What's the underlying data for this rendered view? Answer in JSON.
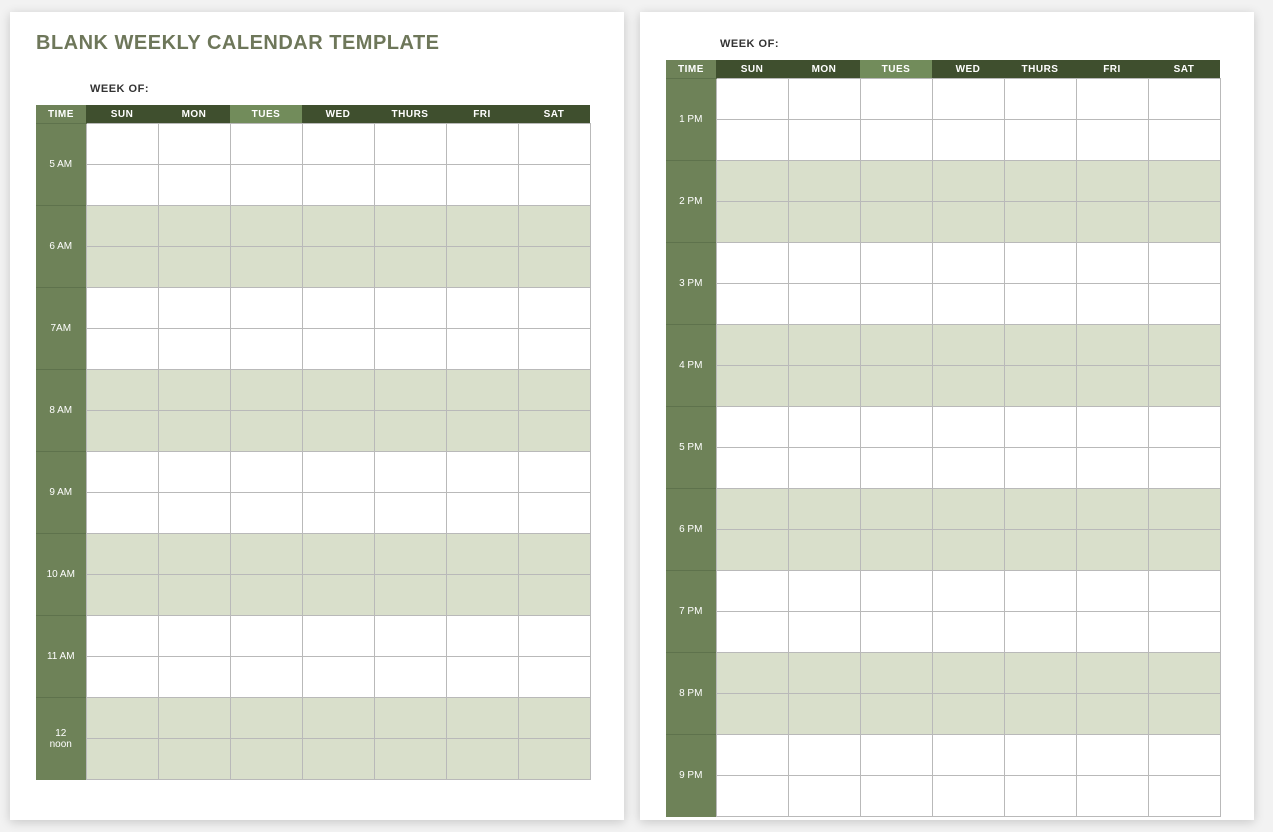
{
  "document": {
    "title": "BLANK WEEKLY CALENDAR TEMPLATE",
    "week_of_label": "WEEK OF:",
    "columns": {
      "time": "TIME",
      "days": [
        "SUN",
        "MON",
        "TUES",
        "WED",
        "THURS",
        "FRI",
        "SAT"
      ]
    },
    "page1_times": [
      "5 AM",
      "6 AM",
      "7AM",
      "8 AM",
      "9 AM",
      "10 AM",
      "11 AM",
      "12\nnoon"
    ],
    "page2_times": [
      "1 PM",
      "2 PM",
      "3 PM",
      "4 PM",
      "5 PM",
      "6 PM",
      "7 PM",
      "8 PM",
      "9 PM"
    ]
  }
}
